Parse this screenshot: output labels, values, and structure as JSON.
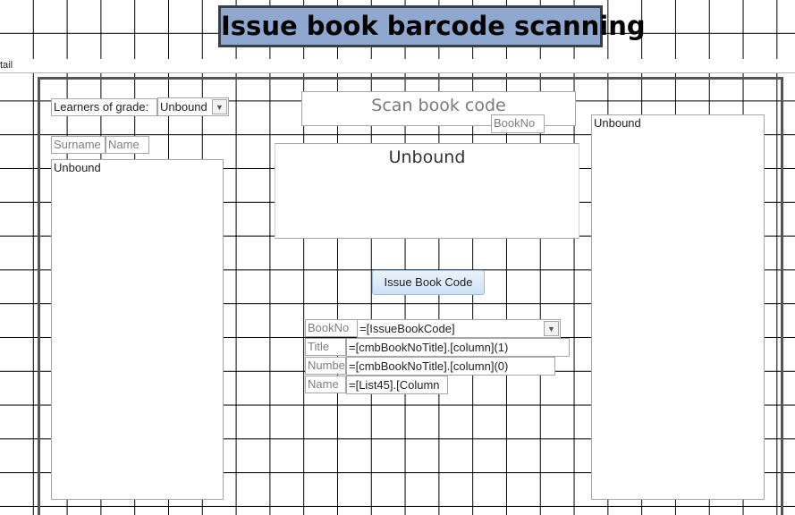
{
  "form": {
    "title": "Issue book barcode scanning",
    "section_label": "tail"
  },
  "left": {
    "grade_label": "Learners of  grade:",
    "grade_combo_value": "Unbound",
    "surname_label": "Surname",
    "name_label": "Name",
    "learners_list_value": "Unbound"
  },
  "center": {
    "scan_label": "Scan book code",
    "bookno_small_label": "BookNo",
    "scan_textbox_value": "Unbound",
    "issue_button_label": "Issue Book Code",
    "rows": {
      "bookno_label": "BookNo",
      "bookno_value": "=[IssueBookCode]",
      "title_label": "Title",
      "title_value": "=[cmbBookNoTitle].[column](1)",
      "number_label": "Numbe",
      "number_value": "=[cmbBookNoTitle].[column](0)",
      "name_label": "Name",
      "name_value": "=[List45].[Column"
    }
  },
  "right": {
    "list_value": "Unbound"
  },
  "icons": {
    "dropdown": "chevron-down-icon"
  }
}
